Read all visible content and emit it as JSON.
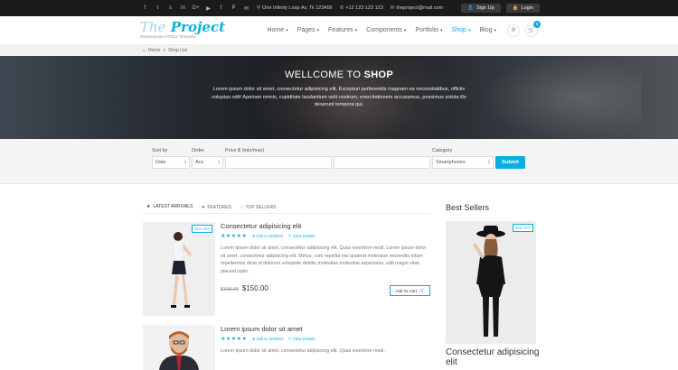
{
  "topbar": {
    "social": [
      "f",
      "t",
      "s",
      "in",
      "G+",
      "▶",
      "f",
      "P",
      "✉"
    ],
    "address": "One Infinity Loop Av, Tk 123456",
    "phone": "+12 123 123 123",
    "email": "theproject@mail.com",
    "signup": "Sign Up",
    "login": "Login"
  },
  "header": {
    "logo_the": "The",
    "logo_project": "Project",
    "tagline": "Multipurpose HTML5 Template",
    "nav": [
      "Home",
      "Pages",
      "Features",
      "Components",
      "Portfolio",
      "Shop",
      "Blog"
    ],
    "cart_count": "0"
  },
  "breadcrumb": {
    "home": "Home",
    "sep": "»",
    "current": "Shop List"
  },
  "banner": {
    "title_pre": "WELLCOME TO ",
    "title_bold": "SHOP",
    "text": "Lorem ipsum dolor sit amet, consectetur adipisicing elit. Excepturi perferendis magnam ea necessitatibus, officiis voluptas odit! Aperiam omnis, cupiditate laudantium velit nostrum, exercitationem accusamus, possimus soluta illo deserunt tempora qui."
  },
  "filter": {
    "sort_label": "Sort by",
    "sort_value": "Date",
    "order_label": "Order",
    "order_value": "Acs",
    "price_label": "Price $ (min/max)",
    "category_label": "Category",
    "category_value": "Smartphones",
    "submit": "Submit"
  },
  "tabs": [
    "LATEST ARRIVALS",
    "FEATURED",
    "TOP SELLERS"
  ],
  "products": [
    {
      "badge": "30% OFF",
      "title": "Consectetur adipisicing elit",
      "stars": "★★★★★",
      "wishlist": "Add to Wishlist",
      "details": "View Details",
      "desc": "Lorem ipsum dolor sit amet, consectetur adipisicing elit. Quas inventore modi. Lorem ipsum dolor sit amet, consectetur adipisicing elit. Minus, cum repellat nisi quaerat molestiae reiciendis totam repellendus dicta id dolorem voluptate debitis molestias molestiae asperiores, odit magni vitae placeat optio.",
      "old_price": "$199.00",
      "price": "$150.00",
      "cart": "Add To Cart"
    },
    {
      "title": "Lorem ipsum dolor sit amet",
      "stars": "★★★★★",
      "wishlist": "Add to Wishlist",
      "details": "View Details",
      "desc": "Lorem ipsum dolor sit amet, consectetur adipisicing elit. Quas inventore modi."
    }
  ],
  "sidebar": {
    "heading": "Best Sellers",
    "badge": "40% OFF",
    "title": "Consectetur adipisicing elit"
  },
  "colors": {
    "accent": "#09afdf",
    "topbar": "#1b1b1b"
  }
}
